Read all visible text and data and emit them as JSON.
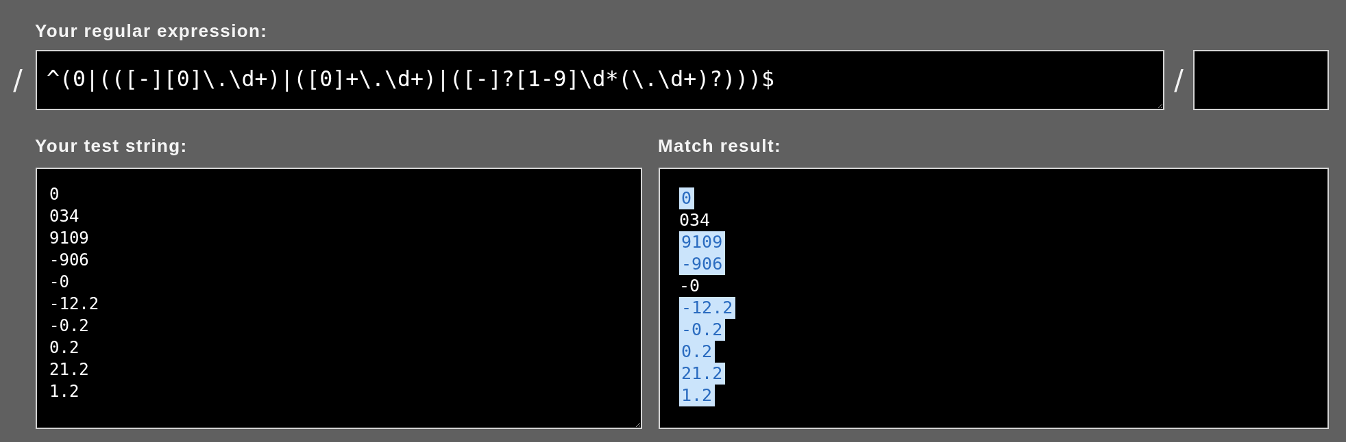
{
  "regex": {
    "label": "Your regular expression:",
    "open_delimiter": "/",
    "value": "^(0|(([-][0]\\.\\d+)|([0]+\\.\\d+)|([-]?[1-9]\\d*(\\.\\d+)?)))$",
    "close_delimiter": "/"
  },
  "test_string": {
    "label": "Your test string:",
    "lines": [
      "0",
      "034",
      "9109",
      "-906",
      "-0",
      "-12.2",
      "-0.2",
      "0.2",
      "21.2",
      "1.2"
    ]
  },
  "match_result": {
    "label": "Match result:",
    "lines": [
      {
        "text": "0",
        "matched": true
      },
      {
        "text": "034",
        "matched": false
      },
      {
        "text": "9109",
        "matched": true
      },
      {
        "text": "-906",
        "matched": true
      },
      {
        "text": "-0",
        "matched": false
      },
      {
        "text": "-12.2",
        "matched": true
      },
      {
        "text": "-0.2",
        "matched": true
      },
      {
        "text": "0.2",
        "matched": true
      },
      {
        "text": "21.2",
        "matched": true
      },
      {
        "text": "1.2",
        "matched": true
      }
    ]
  }
}
